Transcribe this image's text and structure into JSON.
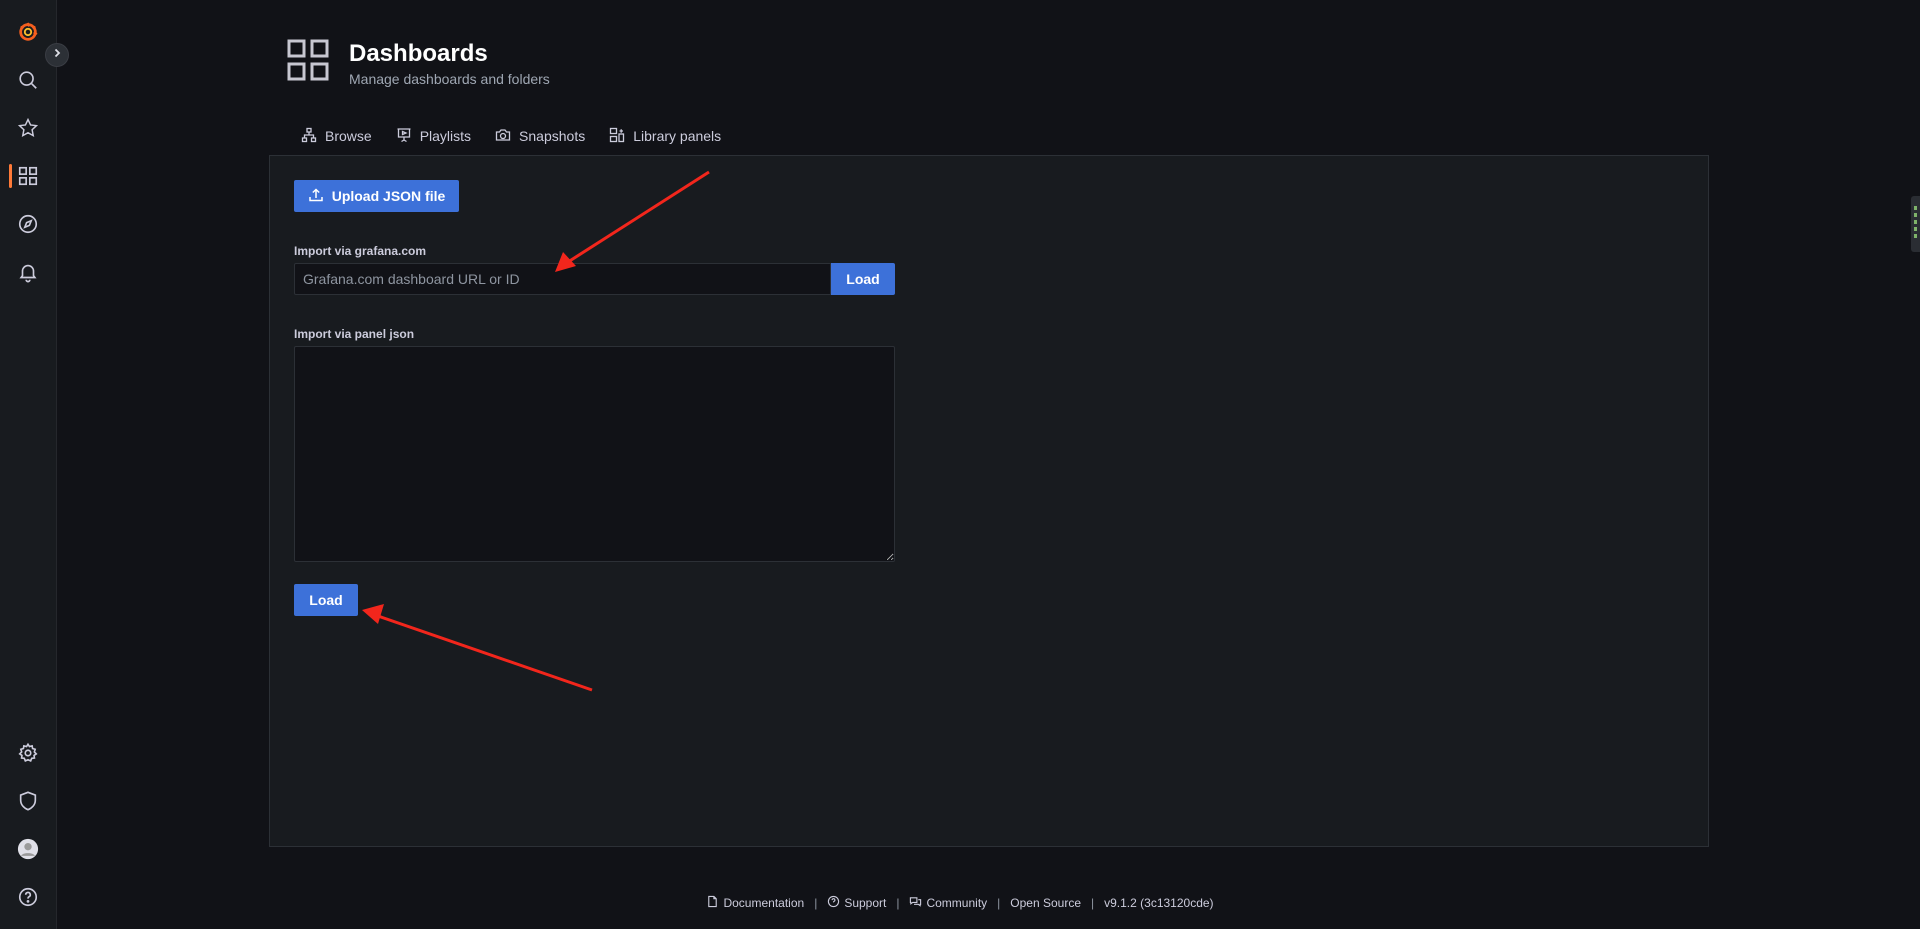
{
  "sidebar": {
    "items": [
      {
        "name": "grafana-logo-icon"
      },
      {
        "name": "search-icon"
      },
      {
        "name": "star-icon"
      },
      {
        "name": "dashboards-icon"
      },
      {
        "name": "explore-icon"
      },
      {
        "name": "alerting-bell-icon"
      },
      {
        "name": "gear-icon"
      },
      {
        "name": "shield-icon"
      },
      {
        "name": "avatar"
      },
      {
        "name": "help-icon"
      }
    ],
    "accent": "#ff7a38"
  },
  "header": {
    "title": "Dashboards",
    "subtitle": "Manage dashboards and folders"
  },
  "tabs": [
    {
      "label": "Browse",
      "icon": "sitemap-icon"
    },
    {
      "label": "Playlists",
      "icon": "presentation-icon"
    },
    {
      "label": "Snapshots",
      "icon": "camera-icon"
    },
    {
      "label": "Library panels",
      "icon": "library-panels-icon"
    }
  ],
  "import": {
    "upload_label": "Upload JSON file",
    "grafana_label": "Import via grafana.com",
    "grafana_placeholder": "Grafana.com dashboard URL or ID",
    "grafana_value": "",
    "load_label": "Load",
    "panel_json_label": "Import via panel json",
    "panel_json_value": "",
    "load_label_2": "Load"
  },
  "footer": {
    "documentation": "Documentation",
    "support": "Support",
    "community": "Community",
    "open_source": "Open Source",
    "version": "v9.1.2 (3c13120cde)",
    "separator": "|"
  },
  "colors": {
    "primary": "#3d71d9",
    "background": "#111217",
    "panel": "#181b1f",
    "annotation_arrow": "#f2261c"
  }
}
